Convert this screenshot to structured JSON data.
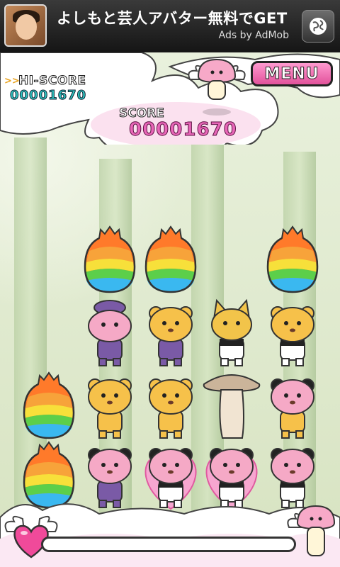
{
  "ad": {
    "title": "よしもと芸人アバター無料でGET",
    "by": "Ads by AdMob",
    "globe_icon": "globe-icon"
  },
  "hud": {
    "hiscore_label": "HI-SCORE",
    "hiscore_value": "00001670",
    "score_label": "SCORE",
    "score_value": "00001670",
    "menu_label": "MENU"
  },
  "board": {
    "columns": 5,
    "rows": 4,
    "cells": [
      [
        "",
        "egg",
        "egg",
        "",
        "egg"
      ],
      [
        "",
        "pink-purple",
        "tiger-purple",
        "fox",
        "tiger-panda"
      ],
      [
        "egg",
        "tiger",
        "tiger",
        "mushroom",
        "pink-panda-tiger"
      ],
      [
        "egg",
        "pink-panda-purple",
        "pink-panda-heart",
        "pink-panda-heart",
        "pink-panda"
      ]
    ]
  },
  "gauge": {
    "level": 0.0
  },
  "colors": {
    "accent": "#e866b8",
    "hiscore": "#2ec4c0",
    "menu": "#f06fb0"
  }
}
